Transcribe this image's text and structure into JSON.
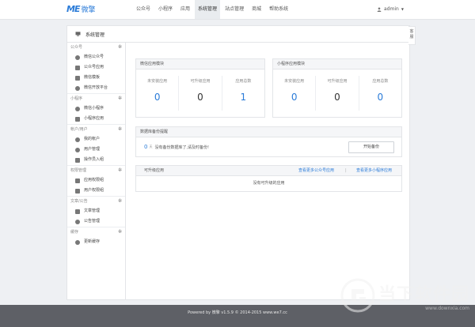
{
  "brand": {
    "mark": "ME",
    "name": "微擎"
  },
  "nav": [
    {
      "label": "公众号",
      "active": false
    },
    {
      "label": "小程序",
      "active": false
    },
    {
      "label": "应用",
      "active": false
    },
    {
      "label": "系统管理",
      "active": true
    },
    {
      "label": "站点管理",
      "active": false
    },
    {
      "label": "商城",
      "active": false
    },
    {
      "label": "帮助系统",
      "active": false
    }
  ],
  "user": {
    "name": "admin"
  },
  "panel": {
    "title": "系统管理"
  },
  "sidebar": {
    "groups": [
      {
        "title": "公众号",
        "items": [
          "微信公众号",
          "公众号应用",
          "微信模板",
          "微信开放平台"
        ]
      },
      {
        "title": "小程序",
        "items": [
          "微信小程序",
          "小程序应用"
        ]
      },
      {
        "title": "帐户/用户",
        "items": [
          "我的帐户",
          "用户管理",
          "操作员入组"
        ]
      },
      {
        "title": "权限管理",
        "items": [
          "应用权限组",
          "用户权限组"
        ]
      },
      {
        "title": "文章/公告",
        "items": [
          "文章管理",
          "公告管理"
        ]
      },
      {
        "title": "缓存",
        "items": [
          "更新缓存"
        ]
      }
    ]
  },
  "wechat_card": {
    "title": "微信应用模块",
    "stats": [
      {
        "label": "未安装应用",
        "value": "0",
        "color": "blue"
      },
      {
        "label": "可升级应用",
        "value": "0",
        "color": "dark"
      },
      {
        "label": "应用总数",
        "value": "1",
        "color": "blue"
      }
    ]
  },
  "mini_card": {
    "title": "小程序应用模块",
    "stats": [
      {
        "label": "未安装应用",
        "value": "0",
        "color": "blue"
      },
      {
        "label": "可升级应用",
        "value": "0",
        "color": "dark"
      },
      {
        "label": "应用总数",
        "value": "0",
        "color": "blue"
      }
    ]
  },
  "backup_card": {
    "title": "数据库备份提醒",
    "days": "0",
    "unit": "天",
    "text": "没有备份数据库了,请及时备份!",
    "button": "开始备份"
  },
  "upgrade_card": {
    "title": "可升级应用",
    "link_official": "查看更多公众号应用",
    "separator": "|",
    "link_mini": "查看更多小程序应用",
    "empty": "没有可升级的应用"
  },
  "side_tab": {
    "label": "客服"
  },
  "footer": {
    "text": "Powered by 微擎 v1.5.9 © 2014-2015 www.we7.cc"
  },
  "watermark": {
    "name": "当下软件园",
    "url": "www.downxia.com"
  }
}
